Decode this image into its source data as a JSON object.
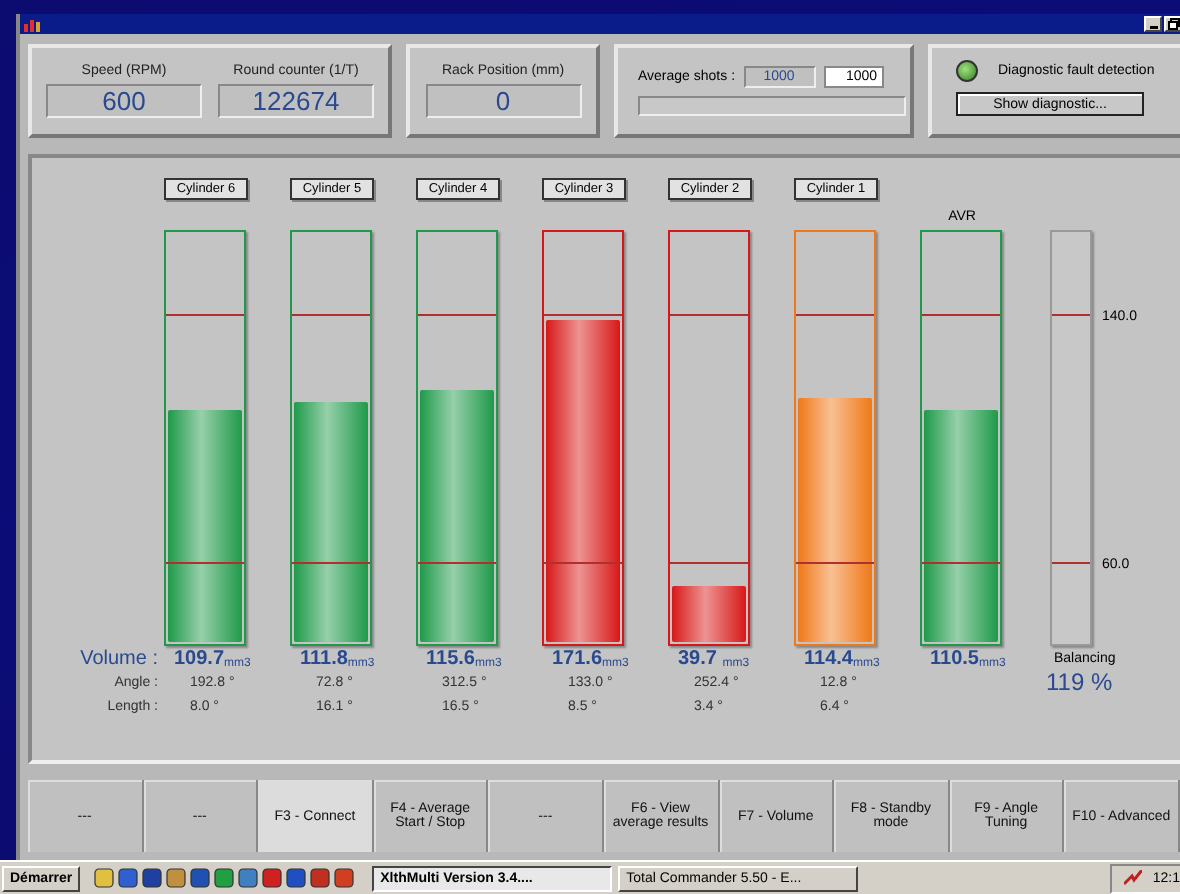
{
  "top_panels": {
    "speed": {
      "label": "Speed (RPM)",
      "value": "600"
    },
    "round_counter": {
      "label": "Round counter (1/T)",
      "value": "122674"
    },
    "rack_position": {
      "label": "Rack Position (mm)",
      "value": "0"
    },
    "average_shots": {
      "label": "Average shots :",
      "current": "1000",
      "input": "1000",
      "level": 0
    },
    "diagnostic": {
      "label": "Diagnostic fault detection",
      "led_on": true,
      "button": "Show diagnostic..."
    }
  },
  "row_labels": {
    "volume": "Volume :",
    "angle": "Angle :",
    "length": "Length :"
  },
  "cylinders": [
    {
      "kind": "cylinder",
      "name": "Cylinder 6",
      "color": "#1f9a4a",
      "level": 0.57,
      "volume": "109.7$_{mm3}$",
      "angle": "192.8 °",
      "length": "8.0 °"
    },
    {
      "kind": "cylinder",
      "name": "Cylinder 5",
      "color": "#1f9a4a",
      "level": 0.59,
      "volume": "111.8$_{mm3}$",
      "angle": "72.8 °",
      "length": "16.1 °"
    },
    {
      "kind": "cylinder",
      "name": "Cylinder 4",
      "color": "#1f9a4a",
      "level": 0.62,
      "volume": "115.6$_{mm3}$",
      "angle": "312.5 °",
      "length": "16.5 °"
    },
    {
      "kind": "cylinder",
      "name": "Cylinder 3",
      "color": "#d81818",
      "level": 0.79,
      "volume": "171.6$_{mm3}$",
      "angle": "133.0 °",
      "length": "8.5 °"
    },
    {
      "kind": "cylinder",
      "name": "Cylinder 2",
      "color": "#d81818",
      "level": 0.135,
      "volume": "39.7 $_{mm3}$",
      "angle": "252.4 °",
      "length": "3.4 °"
    },
    {
      "kind": "cylinder",
      "name": "Cylinder 1",
      "color": "#f07818",
      "level": 0.6,
      "volume": "114.4$_{mm3}$",
      "angle": "12.8 °",
      "length": "6.4 °"
    },
    {
      "kind": "average",
      "name": "AVR",
      "color": "#1f9a4a",
      "level": 0.57,
      "volume": "110.5$_{mm3}$"
    }
  ],
  "scale": {
    "upper": "140.0",
    "lower": "60.0"
  },
  "balancing": {
    "label": "Balancing",
    "value": "119 %"
  },
  "function_keys": [
    {
      "label": "---",
      "selected": false
    },
    {
      "label": "---",
      "selected": false
    },
    {
      "label": "F3 - Connect",
      "selected": true
    },
    {
      "label": "F4 - Average Start / Stop",
      "selected": false
    },
    {
      "label": "---",
      "selected": false
    },
    {
      "label": "F6 - View average results",
      "selected": false
    },
    {
      "label": "F7 - Volume",
      "selected": false
    },
    {
      "label": "F8 - Standby mode",
      "selected": false
    },
    {
      "label": "F9 - Angle Tuning",
      "selected": false
    },
    {
      "label": "F10 - Advanced",
      "selected": false
    }
  ],
  "taskbar": {
    "start": "Démarrer",
    "tasks": [
      {
        "label": "XlthMulti Version 3.4....",
        "selected": true
      },
      {
        "label": "Total Commander 5.50 - E...",
        "selected": false
      }
    ],
    "clock": "12:1"
  }
}
